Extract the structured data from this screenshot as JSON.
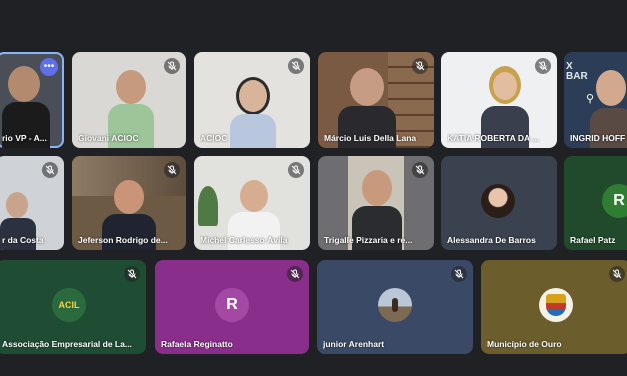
{
  "participants": [
    {
      "name": "rio VP - A...",
      "muted": false,
      "more_icon": "more-dots-icon"
    },
    {
      "name": "Giovani ACIOC",
      "muted": true
    },
    {
      "name": "ACIOC",
      "muted": true
    },
    {
      "name": "Márcio Luis Della Lana",
      "muted": true
    },
    {
      "name": "KATIA ROBERTA DA ...",
      "muted": true
    },
    {
      "name": "INGRID HOFF",
      "muted": false
    },
    {
      "name": "r da Costa",
      "muted": true
    },
    {
      "name": "Jeferson Rodrigo de...",
      "muted": true
    },
    {
      "name": "Michel Carlesso Ávila",
      "muted": true
    },
    {
      "name": "Trigalle Pizzaria e re...",
      "muted": true
    },
    {
      "name": "Alessandra De Barros",
      "muted": false
    },
    {
      "name": "Rafael Patz",
      "muted": false,
      "avatar_letter": "R"
    },
    {
      "name": "Associação Empresarial de La...",
      "muted": true
    },
    {
      "name": "Rafaela Reginatto",
      "muted": true,
      "avatar_letter": "R"
    },
    {
      "name": "junior Arenhart",
      "muted": true
    },
    {
      "name": "Município de Ouro",
      "muted": true
    }
  ],
  "badge_texts": {
    "acil_logo": "ACIL",
    "ingrid_bg_letters": "X\nBAR"
  },
  "colors": {
    "background": "#202124",
    "active_border": "#8ab4f8",
    "alessandra_tile": "#3a4250",
    "rafael_tile": "#214a2c",
    "rafael_avatar": "#2e7d32",
    "acil_tile": "#1f4d34",
    "rafaela_tile": "#8a2e8c",
    "rafaela_avatar": "#a349a4",
    "junior_tile": "#3a4a66",
    "municipio_tile": "#6b5d2c"
  }
}
